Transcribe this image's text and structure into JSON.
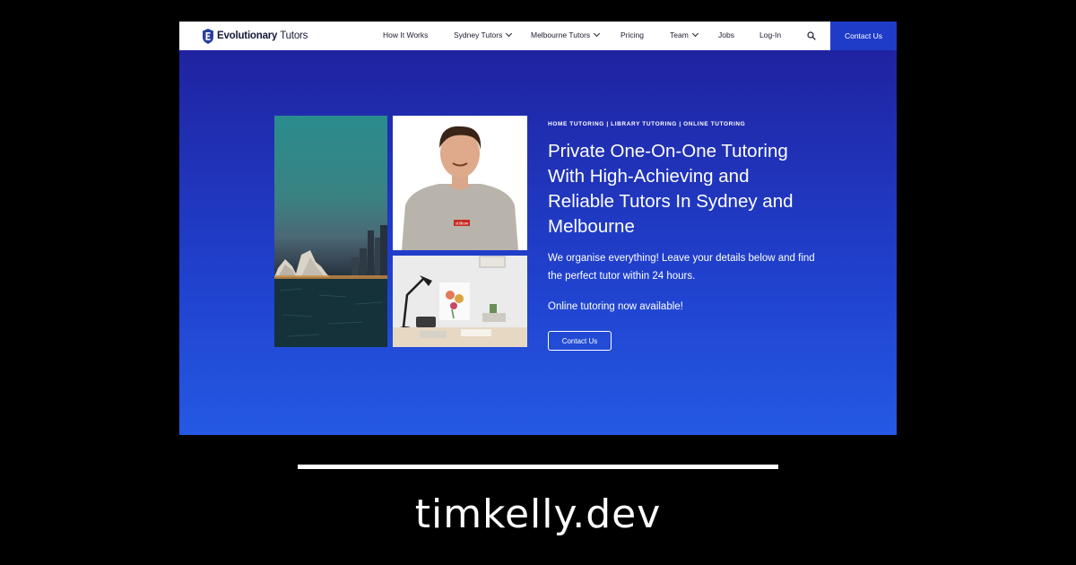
{
  "site": {
    "logo_bold": "Evolutionary",
    "logo_light": "Tutors",
    "nav": [
      {
        "label": "How It Works"
      },
      {
        "label": "Sydney Tutors"
      },
      {
        "label": "Melbourne Tutors"
      },
      {
        "label": "Pricing"
      },
      {
        "label": "Team"
      },
      {
        "label": "Jobs"
      },
      {
        "label": "Log-In"
      }
    ],
    "nav_contact": "Contact Us"
  },
  "hero": {
    "tagline": "HOME TUTORING | LIBRARY TUTORING | ONLINE TUTORING",
    "title": "Private One-On-One Tutoring With High-Achieving and Reliable Tutors In Sydney and Melbourne",
    "description": "We organise everything! Leave your details below and find the perfect tutor within 24 hours.",
    "online_note": "Online tutoring now available!",
    "cta": "Contact Us",
    "shirt_badge": "stilbow"
  },
  "footer": {
    "site_name": "timkelly.dev"
  },
  "colors": {
    "hero_top": "#1f1f9b",
    "hero_bottom": "#2459e3",
    "accent": "#1f3cc9"
  }
}
